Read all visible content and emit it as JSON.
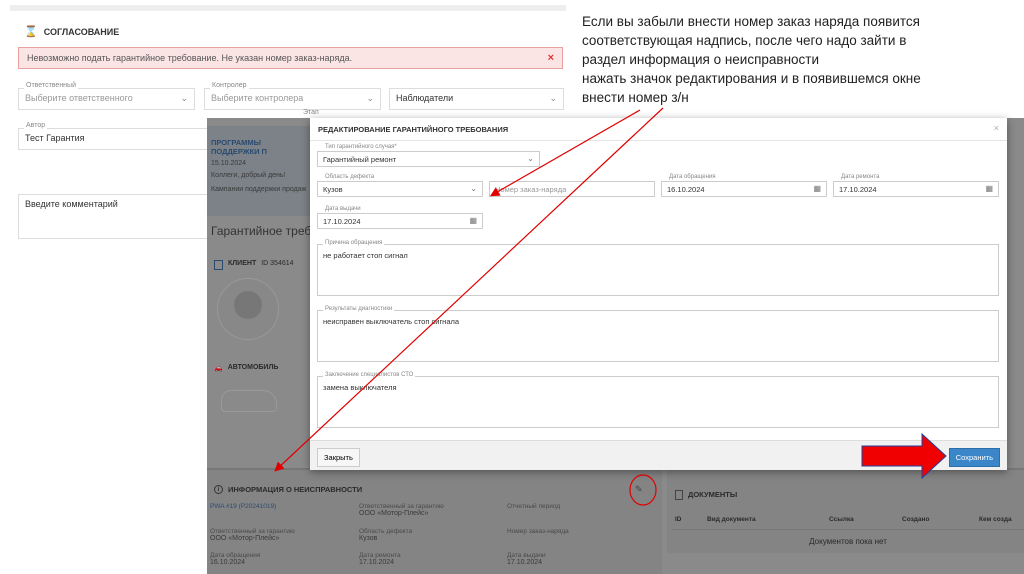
{
  "approval": {
    "title": "СОГЛАСОВАНИЕ",
    "alert": "Невозможно подать гарантийное требование. Не указан номер заказ-наряда.",
    "alert_close": "×",
    "responsible_label": "Ответственный",
    "responsible_placeholder": "Выберите ответственного",
    "controller_label": "Контролер",
    "controller_placeholder": "Выберите контролера",
    "observers": "Наблюдатели",
    "author_label": "Автор",
    "author_value": "Тест Гарантия",
    "stage_label": "Этап",
    "comment_placeholder": "Введите комментарий"
  },
  "background": {
    "programs_title": "ПРОГРАММЫ ПОДДЕРЖКИ П",
    "programs_date": "15.10.2024",
    "programs_greeting": "Коллеги, добрый день!",
    "programs_text": "Кампании поддержки продаж",
    "claim_title": "Гарантийное требов",
    "client_label": "КЛИЕНТ",
    "client_id": "ID 354614",
    "car_label": "АВТОМОБИЛЬ",
    "fault": {
      "title": "ИНФОРМАЦИЯ О НЕИСПРАВНОСТИ",
      "pwa": "PWA #19 (P20241019)",
      "items": [
        {
          "label": "Ответственный за гарантию",
          "value": "ООО «Мотор-Плейс»"
        },
        {
          "label": "Отчетный период",
          "value": ""
        },
        {
          "label": "Ответственный за гарантию",
          "value": "ООО «Мотор-Плейс»"
        },
        {
          "label": "Область дефекта",
          "value": "Кузов"
        },
        {
          "label": "Номер заказ-наряда",
          "value": ""
        },
        {
          "label": "Дата обращения",
          "value": "16.10.2024"
        },
        {
          "label": "Дата ремонта",
          "value": "17.10.2024"
        },
        {
          "label": "Дата выдачи",
          "value": "17.10.2024"
        }
      ]
    },
    "documents": {
      "title": "ДОКУМЕНТЫ",
      "columns": [
        "ID",
        "Вид документа",
        "Ссылка",
        "Создано",
        "Кем созда"
      ],
      "empty": "Документов пока нет"
    }
  },
  "modal": {
    "title": "РЕДАКТИРОВАНИЕ ГАРАНТИЙНОГО ТРЕБОВАНИЯ",
    "close": "×",
    "case_type_label": "Тип гарантийного случая*",
    "case_type_value": "Гарантийный ремонт",
    "defect_area_label": "Область дефекта",
    "defect_area_value": "Кузов",
    "order_placeholder": "Номер заказ-наряда",
    "request_date_label": "Дата обращения",
    "request_date": "16.10.2024",
    "repair_date_label": "Дата ремонта",
    "repair_date": "17.10.2024",
    "issue_date_label": "Дата выдачи",
    "issue_date": "17.10.2024",
    "reason_label": "Причина обращения",
    "reason": "не работает стоп сигнал",
    "diag_label": "Результаты диагностики",
    "diag": "неисправен выключатель стоп сигнала",
    "conclusion_label": "Заключение специалистов СТО",
    "conclusion": "замена выключателя",
    "close_button": "Закрыть",
    "save_button": "Сохранить"
  },
  "annotation": {
    "lines": [
      "Если вы забыли внести номер заказ наряда появится",
      "соответствующая надпись, после чего надо зайти в",
      "раздел информация о неисправности",
      "нажать значок редактирования и в появившемся окне",
      "внести номер з/н"
    ]
  },
  "colors": {
    "accent": "#3a86c8",
    "annotation_red": "#e00000"
  }
}
